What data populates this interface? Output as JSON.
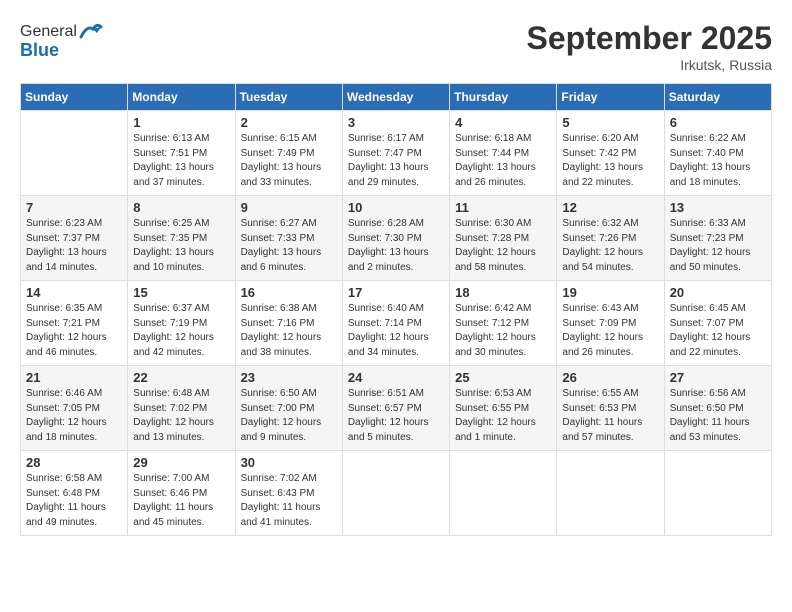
{
  "header": {
    "logo_line1": "General",
    "logo_line2": "Blue",
    "month": "September 2025",
    "location": "Irkutsk, Russia"
  },
  "weekdays": [
    "Sunday",
    "Monday",
    "Tuesday",
    "Wednesday",
    "Thursday",
    "Friday",
    "Saturday"
  ],
  "weeks": [
    [
      {
        "day": "",
        "info": ""
      },
      {
        "day": "1",
        "info": "Sunrise: 6:13 AM\nSunset: 7:51 PM\nDaylight: 13 hours\nand 37 minutes."
      },
      {
        "day": "2",
        "info": "Sunrise: 6:15 AM\nSunset: 7:49 PM\nDaylight: 13 hours\nand 33 minutes."
      },
      {
        "day": "3",
        "info": "Sunrise: 6:17 AM\nSunset: 7:47 PM\nDaylight: 13 hours\nand 29 minutes."
      },
      {
        "day": "4",
        "info": "Sunrise: 6:18 AM\nSunset: 7:44 PM\nDaylight: 13 hours\nand 26 minutes."
      },
      {
        "day": "5",
        "info": "Sunrise: 6:20 AM\nSunset: 7:42 PM\nDaylight: 13 hours\nand 22 minutes."
      },
      {
        "day": "6",
        "info": "Sunrise: 6:22 AM\nSunset: 7:40 PM\nDaylight: 13 hours\nand 18 minutes."
      }
    ],
    [
      {
        "day": "7",
        "info": "Sunrise: 6:23 AM\nSunset: 7:37 PM\nDaylight: 13 hours\nand 14 minutes."
      },
      {
        "day": "8",
        "info": "Sunrise: 6:25 AM\nSunset: 7:35 PM\nDaylight: 13 hours\nand 10 minutes."
      },
      {
        "day": "9",
        "info": "Sunrise: 6:27 AM\nSunset: 7:33 PM\nDaylight: 13 hours\nand 6 minutes."
      },
      {
        "day": "10",
        "info": "Sunrise: 6:28 AM\nSunset: 7:30 PM\nDaylight: 13 hours\nand 2 minutes."
      },
      {
        "day": "11",
        "info": "Sunrise: 6:30 AM\nSunset: 7:28 PM\nDaylight: 12 hours\nand 58 minutes."
      },
      {
        "day": "12",
        "info": "Sunrise: 6:32 AM\nSunset: 7:26 PM\nDaylight: 12 hours\nand 54 minutes."
      },
      {
        "day": "13",
        "info": "Sunrise: 6:33 AM\nSunset: 7:23 PM\nDaylight: 12 hours\nand 50 minutes."
      }
    ],
    [
      {
        "day": "14",
        "info": "Sunrise: 6:35 AM\nSunset: 7:21 PM\nDaylight: 12 hours\nand 46 minutes."
      },
      {
        "day": "15",
        "info": "Sunrise: 6:37 AM\nSunset: 7:19 PM\nDaylight: 12 hours\nand 42 minutes."
      },
      {
        "day": "16",
        "info": "Sunrise: 6:38 AM\nSunset: 7:16 PM\nDaylight: 12 hours\nand 38 minutes."
      },
      {
        "day": "17",
        "info": "Sunrise: 6:40 AM\nSunset: 7:14 PM\nDaylight: 12 hours\nand 34 minutes."
      },
      {
        "day": "18",
        "info": "Sunrise: 6:42 AM\nSunset: 7:12 PM\nDaylight: 12 hours\nand 30 minutes."
      },
      {
        "day": "19",
        "info": "Sunrise: 6:43 AM\nSunset: 7:09 PM\nDaylight: 12 hours\nand 26 minutes."
      },
      {
        "day": "20",
        "info": "Sunrise: 6:45 AM\nSunset: 7:07 PM\nDaylight: 12 hours\nand 22 minutes."
      }
    ],
    [
      {
        "day": "21",
        "info": "Sunrise: 6:46 AM\nSunset: 7:05 PM\nDaylight: 12 hours\nand 18 minutes."
      },
      {
        "day": "22",
        "info": "Sunrise: 6:48 AM\nSunset: 7:02 PM\nDaylight: 12 hours\nand 13 minutes."
      },
      {
        "day": "23",
        "info": "Sunrise: 6:50 AM\nSunset: 7:00 PM\nDaylight: 12 hours\nand 9 minutes."
      },
      {
        "day": "24",
        "info": "Sunrise: 6:51 AM\nSunset: 6:57 PM\nDaylight: 12 hours\nand 5 minutes."
      },
      {
        "day": "25",
        "info": "Sunrise: 6:53 AM\nSunset: 6:55 PM\nDaylight: 12 hours\nand 1 minute."
      },
      {
        "day": "26",
        "info": "Sunrise: 6:55 AM\nSunset: 6:53 PM\nDaylight: 11 hours\nand 57 minutes."
      },
      {
        "day": "27",
        "info": "Sunrise: 6:56 AM\nSunset: 6:50 PM\nDaylight: 11 hours\nand 53 minutes."
      }
    ],
    [
      {
        "day": "28",
        "info": "Sunrise: 6:58 AM\nSunset: 6:48 PM\nDaylight: 11 hours\nand 49 minutes."
      },
      {
        "day": "29",
        "info": "Sunrise: 7:00 AM\nSunset: 6:46 PM\nDaylight: 11 hours\nand 45 minutes."
      },
      {
        "day": "30",
        "info": "Sunrise: 7:02 AM\nSunset: 6:43 PM\nDaylight: 11 hours\nand 41 minutes."
      },
      {
        "day": "",
        "info": ""
      },
      {
        "day": "",
        "info": ""
      },
      {
        "day": "",
        "info": ""
      },
      {
        "day": "",
        "info": ""
      }
    ]
  ]
}
